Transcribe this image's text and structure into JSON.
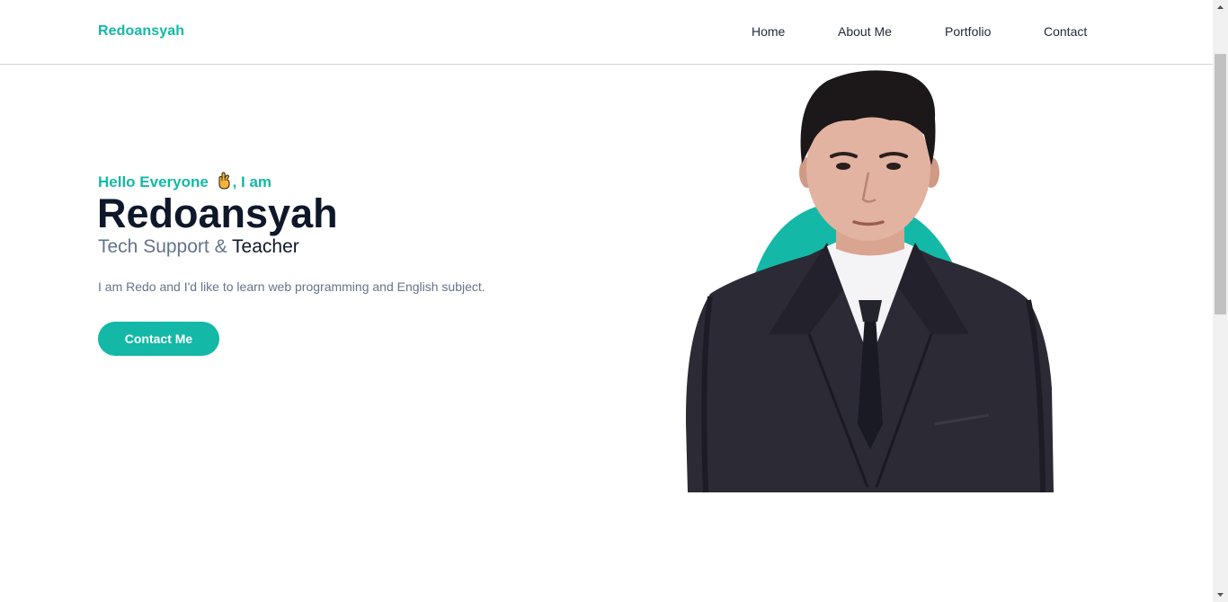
{
  "navbar": {
    "brand": "Redoansyah",
    "links": [
      "Home",
      "About Me",
      "Portfolio",
      "Contact"
    ]
  },
  "hero": {
    "greeting_prefix": "Hello Everyone ",
    "greeting_icon": "crossed-fingers-icon",
    "greeting_suffix": ", I am",
    "name": "Redoansyah",
    "role_primary": "Tech Support & ",
    "role_accent": "Teacher",
    "description": "I am Redo and I'd like to learn web programming and English subject.",
    "cta_label": "Contact Me",
    "image": "profile-photo"
  },
  "colors": {
    "accent": "#14b8a6",
    "heading": "#0f172a",
    "muted": "#64748b",
    "nav_text": "#1f2937"
  }
}
